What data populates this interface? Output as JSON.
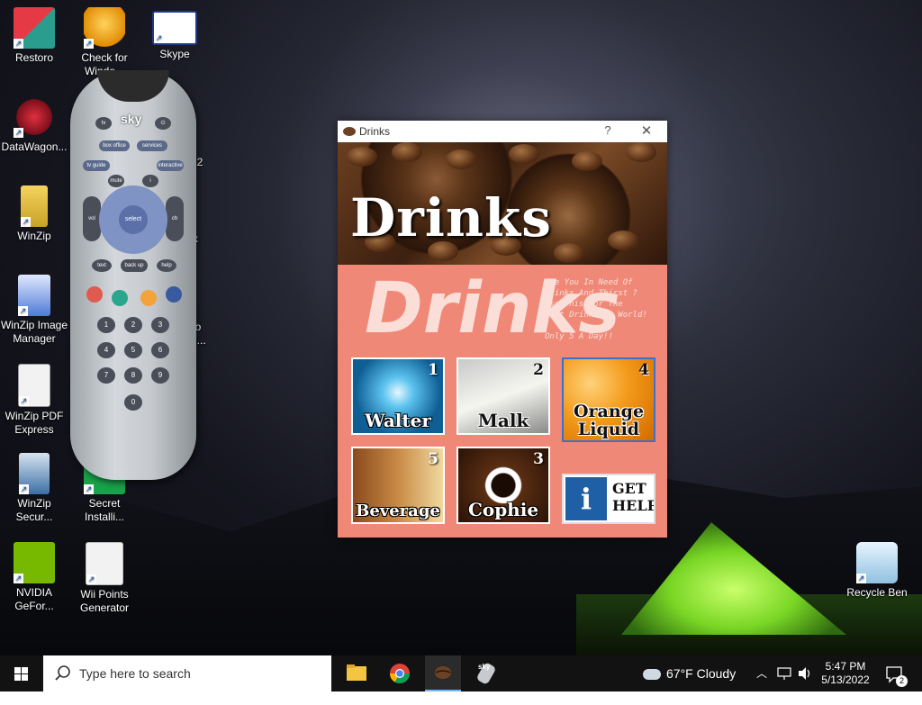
{
  "desktop": {
    "icons": [
      {
        "label": "Restoro"
      },
      {
        "label": "Check for Windo..."
      },
      {
        "label": "Skype"
      },
      {
        "label": "DataWagon..."
      },
      {
        "label": "WinZip"
      },
      {
        "label": "WinZip Image Manager"
      },
      {
        "label": "WinZip PDF Express"
      },
      {
        "label": "WinZip Secur..."
      },
      {
        "label": "Secret Installi..."
      },
      {
        "label": "NVIDIA GeFor..."
      },
      {
        "label": "Wii Points Generator"
      },
      {
        "label": "Recycle Ben"
      }
    ],
    "partial_labels": {
      "a": "y",
      "b": "12",
      "c": "x",
      "d": "io",
      "e": "n...",
      "f": "Or",
      "g": "it",
      "h": "ader"
    }
  },
  "remote": {
    "logo": "sky",
    "buttons": {
      "tv": "tv",
      "box_office": "box office",
      "services": "services",
      "tv_guide": "tv guide",
      "interactive": "interactive",
      "mute": "mute",
      "info": "i",
      "vol": "vol",
      "ch": "ch",
      "select": "select",
      "text": "text",
      "back_up": "back up",
      "help": "help"
    },
    "numbers": [
      "1",
      "2",
      "3",
      "4",
      "5",
      "6",
      "7",
      "8",
      "9",
      "0"
    ]
  },
  "drinks_window": {
    "title": "Drinks",
    "help_button": "?",
    "close_button": "✕",
    "banner_word": "Drinks",
    "big_word": "Drinks",
    "tagline": [
      "Are You In Need Of",
      "Drinks And Thirst ?",
      "Use This For The",
      "Best Drinks In World!",
      "",
      "Only 5 A Day!!"
    ],
    "tiles": [
      {
        "label": "Walter",
        "number": "1"
      },
      {
        "label": "Malk",
        "number": "2"
      },
      {
        "label": "Orange Liquid",
        "number": "4"
      },
      {
        "label": "Beverage",
        "number": "5"
      },
      {
        "label": "Cophie",
        "number": "3"
      },
      {
        "label": "GET HELP",
        "number": ""
      }
    ]
  },
  "taskbar": {
    "search_placeholder": "Type here to search",
    "weather": "67°F  Cloudy",
    "time": "5:47 PM",
    "date": "5/13/2022",
    "notification_count": "2"
  }
}
